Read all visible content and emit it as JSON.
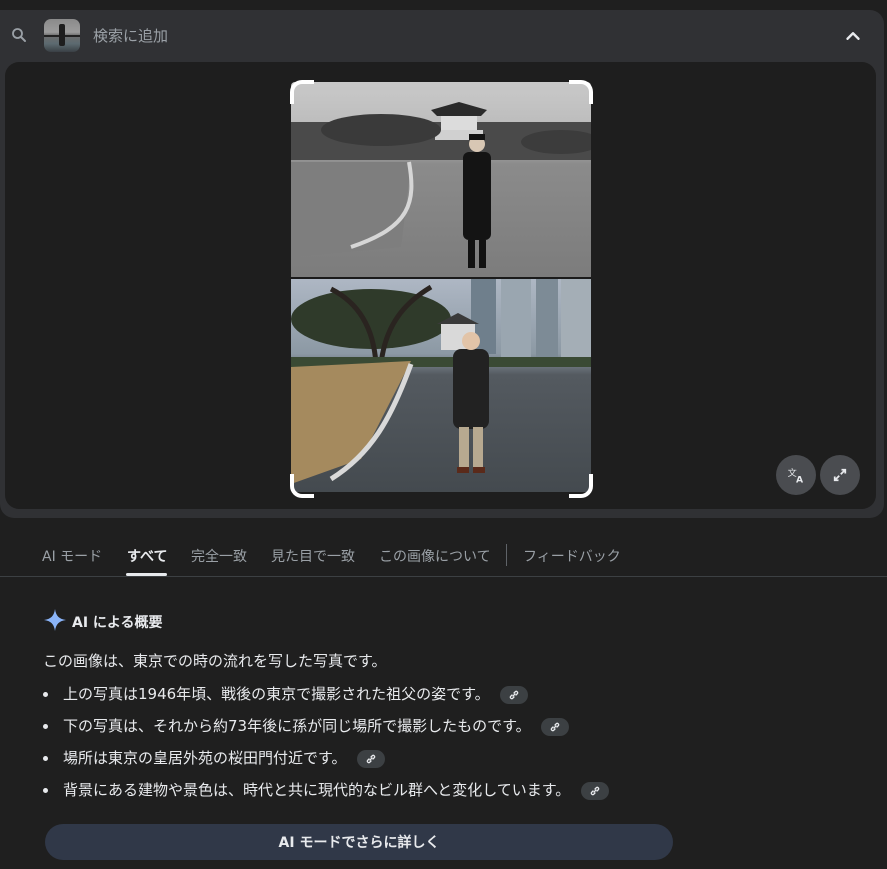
{
  "search": {
    "placeholder": "検索に追加"
  },
  "tabs": [
    {
      "label": "AI モード",
      "active": false
    },
    {
      "label": "すべて",
      "active": true
    },
    {
      "label": "完全一致",
      "active": false
    },
    {
      "label": "見た目で一致",
      "active": false
    },
    {
      "label": "この画像について",
      "active": false
    },
    {
      "label": "フィードバック",
      "active": false
    }
  ],
  "overview": {
    "title": "AI による概要",
    "intro": "この画像は、東京での時の流れを写した写真です。",
    "bullets": [
      "上の写真は1946年頃、戦後の東京で撮影された祖父の姿です。",
      "下の写真は、それから約73年後に孫が同じ場所で撮影したものです。",
      "場所は東京の皇居外苑の桜田門付近です。",
      "背景にある建物や景色は、時代と共に現代的なビル群へと変化しています。"
    ],
    "more_button": "AI モードでさらに詳しく"
  },
  "icons": {
    "search": "search-icon",
    "collapse": "chevron-up-icon",
    "translate": "translate-icon",
    "expand": "expand-icon",
    "sparkle": "sparkle-icon",
    "link": "link-icon"
  },
  "colors": {
    "background": "#1f1f1f",
    "panel": "#303134",
    "accent_sparkle": "#8ab4f8",
    "button": "#303848"
  }
}
